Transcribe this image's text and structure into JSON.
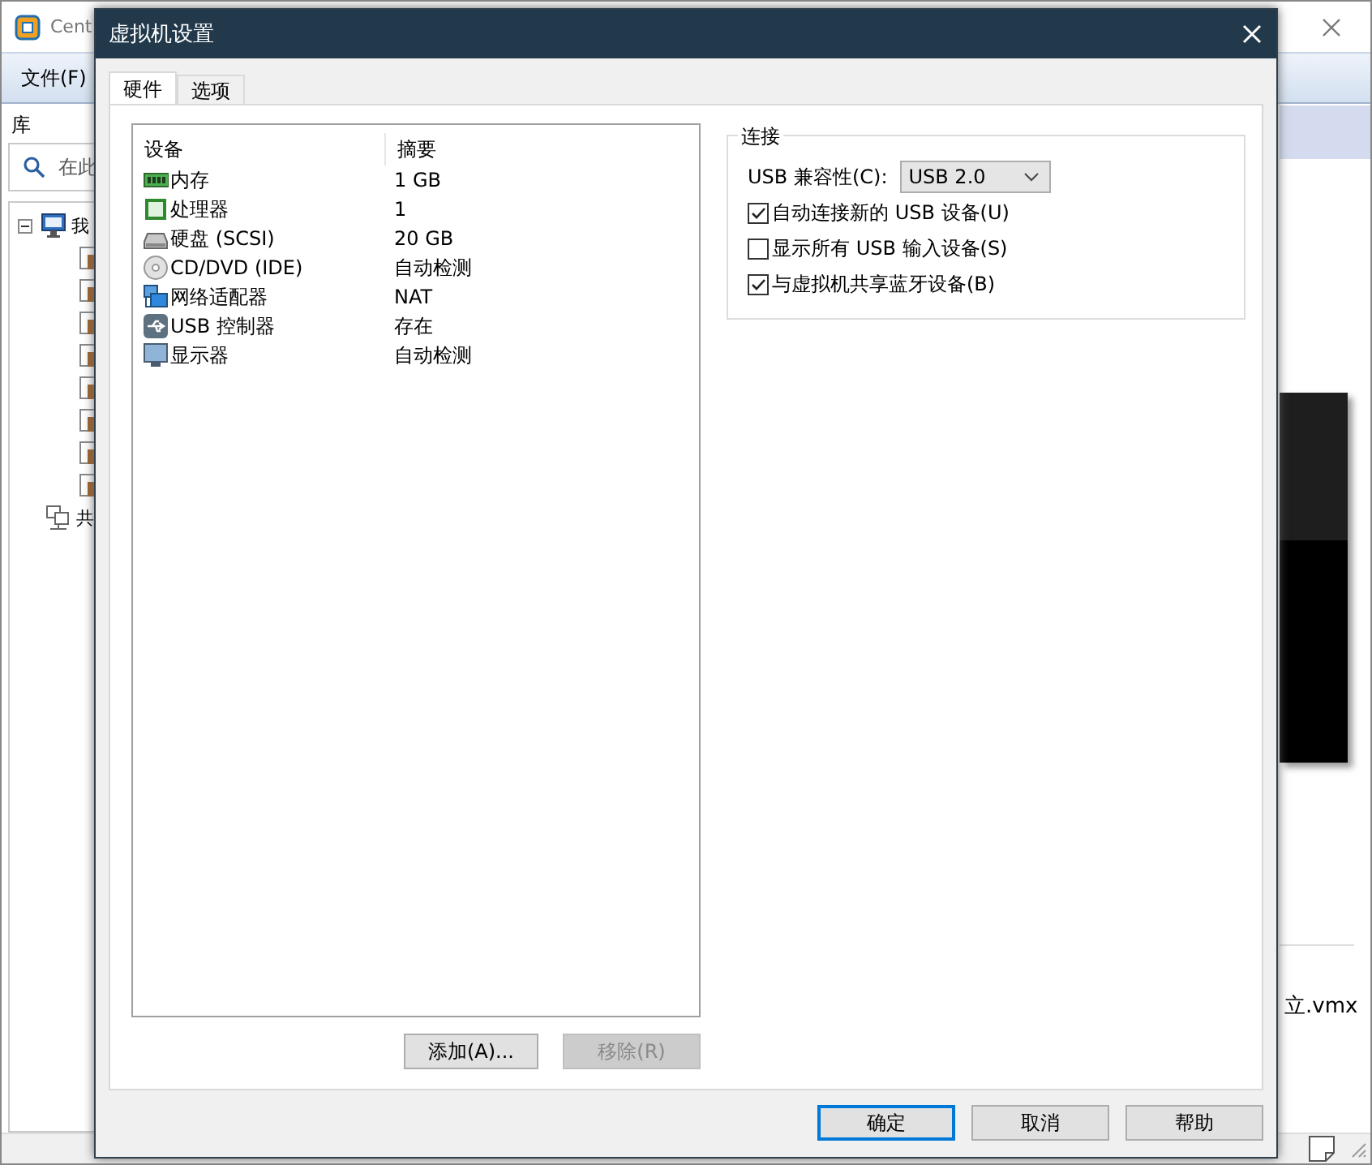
{
  "app": {
    "title": "Cent",
    "menu": [
      {
        "label": "文件(F)"
      }
    ],
    "library": {
      "title": "库",
      "search_placeholder": "在此",
      "tree": [
        {
          "label": "我",
          "kind": "computer",
          "expanded": true,
          "children": [
            {
              "kind": "vm"
            },
            {
              "kind": "vm"
            },
            {
              "kind": "vm"
            },
            {
              "kind": "vm"
            },
            {
              "kind": "vm"
            },
            {
              "kind": "vm"
            },
            {
              "kind": "vm"
            },
            {
              "kind": "vm"
            }
          ]
        },
        {
          "label": "共",
          "kind": "shared"
        }
      ]
    },
    "file_label": "立.vmx"
  },
  "dialog": {
    "title": "虚拟机设置",
    "tabs": [
      {
        "label": "硬件",
        "selected": true
      },
      {
        "label": "选项",
        "selected": false
      }
    ],
    "devices": {
      "columns": [
        "设备",
        "摘要"
      ],
      "rows": [
        {
          "kind": "memory",
          "device": "内存",
          "summary": "1 GB",
          "selected": false
        },
        {
          "kind": "cpu",
          "device": "处理器",
          "summary": "1",
          "selected": false
        },
        {
          "kind": "disk",
          "device": "硬盘 (SCSI)",
          "summary": "20 GB",
          "selected": false
        },
        {
          "kind": "cd",
          "device": "CD/DVD (IDE)",
          "summary": "自动检测",
          "selected": false
        },
        {
          "kind": "network",
          "device": "网络适配器",
          "summary": "NAT",
          "selected": false
        },
        {
          "kind": "usb",
          "device": "USB 控制器",
          "summary": "存在",
          "selected": false
        },
        {
          "kind": "display",
          "device": "显示器",
          "summary": "自动检测",
          "selected": false
        }
      ]
    },
    "list_buttons": [
      {
        "label": "添加(A)...",
        "disabled": false
      },
      {
        "label": "移除(R)",
        "disabled": true
      }
    ],
    "connection": {
      "title": "连接",
      "compat_label": "USB 兼容性(C):",
      "compat_value": "USB 2.0",
      "options": [
        {
          "label": "自动连接新的 USB 设备(U)",
          "checked": true
        },
        {
          "label": "显示所有 USB 输入设备(S)",
          "checked": false
        },
        {
          "label": "与虚拟机共享蓝牙设备(B)",
          "checked": true
        }
      ]
    },
    "buttons": [
      {
        "label": "确定",
        "default": true
      },
      {
        "label": "取消",
        "default": false
      },
      {
        "label": "帮助",
        "default": false
      }
    ]
  }
}
